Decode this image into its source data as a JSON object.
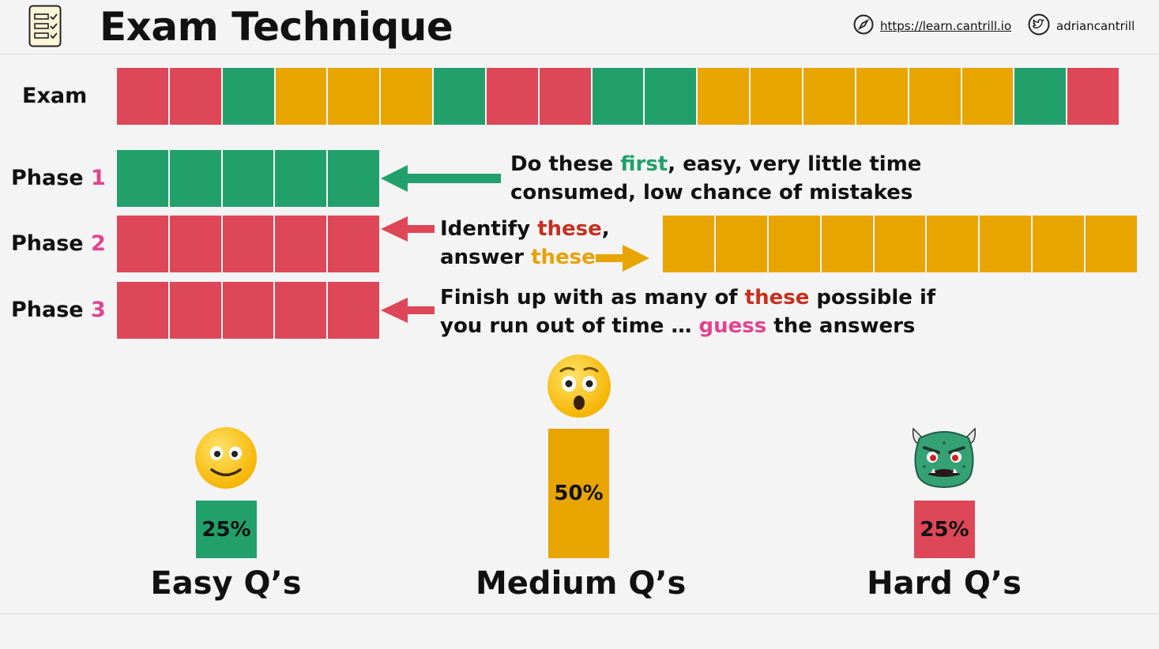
{
  "header": {
    "title": "Exam Technique",
    "website": "https://learn.cantrill.io",
    "twitter": "adriancantrill",
    "logo_icon": "checklist-icon",
    "website_icon": "compass-icon",
    "twitter_icon": "twitter-icon"
  },
  "colors": {
    "green": "#22a06b",
    "red": "#dd4758",
    "orange": "#e8a500",
    "pink": "#e0458f"
  },
  "exam": {
    "label": "Exam",
    "blocks": [
      "red",
      "red",
      "green",
      "orange",
      "orange",
      "orange",
      "green",
      "red",
      "red",
      "green",
      "green",
      "orange",
      "orange",
      "orange",
      "orange",
      "orange",
      "orange",
      "green",
      "red"
    ]
  },
  "phases": [
    {
      "label": "Phase",
      "number": "1",
      "block_color": "green",
      "block_count": 5
    },
    {
      "label": "Phase",
      "number": "2",
      "block_color": "red",
      "block_count": 5
    },
    {
      "label": "Phase",
      "number": "3",
      "block_color": "red",
      "block_count": 5
    }
  ],
  "phase2_answer": {
    "block_color": "orange",
    "block_count": 9
  },
  "callouts": {
    "phase1": {
      "line1_a": "Do these ",
      "line1_b": "first",
      "line1_c": ", easy, very little time",
      "line2": "consumed, low chance of mistakes"
    },
    "phase2": {
      "line1_a": "Identify ",
      "line1_b": "these",
      "line1_c": ",",
      "line2_a": "answer ",
      "line2_b": "these"
    },
    "phase3": {
      "line1_a": "Finish up with as many of ",
      "line1_b": "these",
      "line1_c": " possible if",
      "line2_a": "you run out of time … ",
      "line2_b": "guess",
      "line2_c": " the answers"
    }
  },
  "distribution": [
    {
      "label": "Easy Q’s",
      "percent": "25%",
      "share": 0.25,
      "color": "green",
      "face": "smiling-face-icon"
    },
    {
      "label": "Medium Q’s",
      "percent": "50%",
      "share": 0.5,
      "color": "orange",
      "face": "astonished-face-icon"
    },
    {
      "label": "Hard Q’s",
      "percent": "25%",
      "share": 0.25,
      "color": "red",
      "face": "angry-monster-icon"
    }
  ]
}
